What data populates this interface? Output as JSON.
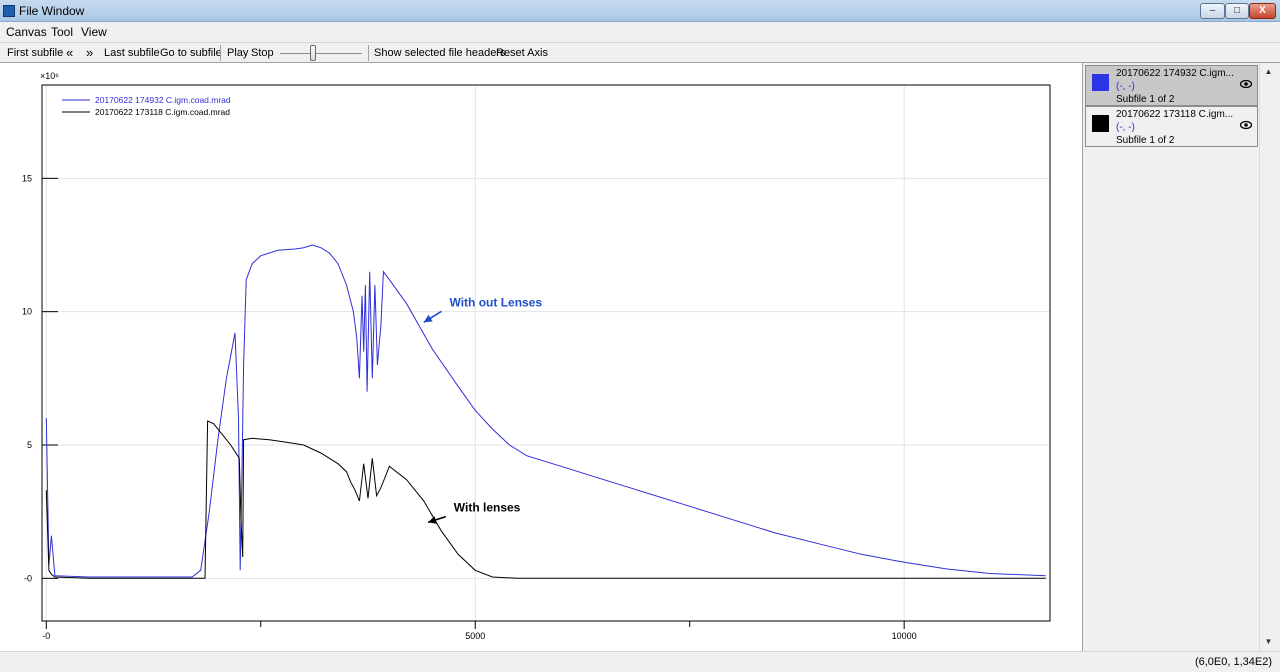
{
  "window": {
    "title": "File Window",
    "minimize": "–",
    "maximize": "□",
    "close": "X"
  },
  "menu": [
    "Canvas",
    "Tool",
    "View"
  ],
  "toolbar": {
    "first_subfile": "First subfile",
    "prev_icon": "«",
    "next_icon": "»",
    "last_subfile": "Last subfile",
    "go_to_subfile": "Go to subfile",
    "play": "Play",
    "stop": "Stop",
    "show_headers": "Show selected file headers",
    "reset_axis": "Reset Axis"
  },
  "colors": {
    "series_blue": "#2f2fd6",
    "series_black": "#000000",
    "annotation_blue": "#1f4fc8",
    "swatch_blue": "#2c35e6"
  },
  "legend_panel": [
    {
      "name": "20170622 174932 C.igm...",
      "coords": "(-, -)",
      "subfile": "Subfile 1 of 2",
      "color": "#2c35e6",
      "selected": true
    },
    {
      "name": "20170622 173118 C.igm...",
      "coords": "(-, -)",
      "subfile": "Subfile 1 of 2",
      "color": "#000000",
      "selected": false
    }
  ],
  "status": {
    "coords": "(6,0E0, 1,34E2)"
  },
  "chart_data": {
    "type": "line",
    "title": "",
    "xlabel": "",
    "ylabel": "",
    "y_multiplier": "×10⁶",
    "xlim": [
      -50,
      11700
    ],
    "ylim": [
      -1.6,
      18.5
    ],
    "x_ticks": [
      {
        "v": 0,
        "label": "-0"
      },
      {
        "v": 5000,
        "label": "5000"
      },
      {
        "v": 10000,
        "label": "10000"
      }
    ],
    "y_ticks": [
      {
        "v": 0,
        "label": "-0"
      },
      {
        "v": 5,
        "label": "5"
      },
      {
        "v": 10,
        "label": "10"
      },
      {
        "v": 15,
        "label": "15"
      }
    ],
    "grid": true,
    "legend_placement": "top-left",
    "series": [
      {
        "name": "20170622 174932 C.igm.coad.mrad",
        "color": "#2f2fd6",
        "points": [
          [
            0,
            6.0
          ],
          [
            30,
            0.5
          ],
          [
            60,
            1.6
          ],
          [
            100,
            0.1
          ],
          [
            500,
            0.05
          ],
          [
            1700,
            0.05
          ],
          [
            1800,
            0.3
          ],
          [
            1900,
            2.5
          ],
          [
            2000,
            5.2
          ],
          [
            2100,
            7.5
          ],
          [
            2200,
            9.2
          ],
          [
            2240,
            6.0
          ],
          [
            2260,
            0.3
          ],
          [
            2280,
            3.8
          ],
          [
            2300,
            8.0
          ],
          [
            2330,
            11.2
          ],
          [
            2400,
            11.8
          ],
          [
            2500,
            12.1
          ],
          [
            2700,
            12.3
          ],
          [
            2900,
            12.35
          ],
          [
            3000,
            12.4
          ],
          [
            3100,
            12.5
          ],
          [
            3200,
            12.4
          ],
          [
            3300,
            12.2
          ],
          [
            3400,
            11.8
          ],
          [
            3500,
            11.0
          ],
          [
            3580,
            10.0
          ],
          [
            3620,
            9.0
          ],
          [
            3650,
            7.5
          ],
          [
            3680,
            10.6
          ],
          [
            3700,
            8.5
          ],
          [
            3720,
            11.0
          ],
          [
            3740,
            7.0
          ],
          [
            3770,
            11.5
          ],
          [
            3800,
            7.5
          ],
          [
            3830,
            11.0
          ],
          [
            3860,
            8.0
          ],
          [
            3900,
            9.5
          ],
          [
            3930,
            11.5
          ],
          [
            4000,
            11.2
          ],
          [
            4200,
            10.3
          ],
          [
            4500,
            8.6
          ],
          [
            4800,
            7.2
          ],
          [
            5000,
            6.3
          ],
          [
            5200,
            5.6
          ],
          [
            5400,
            5.0
          ],
          [
            5600,
            4.6
          ],
          [
            6000,
            4.2
          ],
          [
            6500,
            3.7
          ],
          [
            7000,
            3.2
          ],
          [
            7500,
            2.7
          ],
          [
            8000,
            2.2
          ],
          [
            8500,
            1.7
          ],
          [
            9000,
            1.3
          ],
          [
            9500,
            0.9
          ],
          [
            10000,
            0.6
          ],
          [
            10500,
            0.35
          ],
          [
            11000,
            0.18
          ],
          [
            11650,
            0.1
          ]
        ]
      },
      {
        "name": "20170622 173118 C.igm.coad.mrad",
        "color": "#000000",
        "points": [
          [
            0,
            3.3
          ],
          [
            30,
            0.3
          ],
          [
            60,
            0.15
          ],
          [
            100,
            0.05
          ],
          [
            500,
            0.0
          ],
          [
            1850,
            0.0
          ],
          [
            1880,
            5.9
          ],
          [
            1950,
            5.8
          ],
          [
            2050,
            5.4
          ],
          [
            2150,
            5.0
          ],
          [
            2250,
            4.5
          ],
          [
            2270,
            2.2
          ],
          [
            2290,
            0.8
          ],
          [
            2300,
            5.2
          ],
          [
            2400,
            5.25
          ],
          [
            2600,
            5.2
          ],
          [
            2800,
            5.1
          ],
          [
            3000,
            5.0
          ],
          [
            3200,
            4.7
          ],
          [
            3400,
            4.3
          ],
          [
            3500,
            4.0
          ],
          [
            3550,
            3.6
          ],
          [
            3600,
            3.3
          ],
          [
            3650,
            2.9
          ],
          [
            3700,
            4.3
          ],
          [
            3750,
            3.0
          ],
          [
            3800,
            4.5
          ],
          [
            3850,
            3.1
          ],
          [
            3900,
            3.4
          ],
          [
            4000,
            4.2
          ],
          [
            4200,
            3.7
          ],
          [
            4400,
            2.9
          ],
          [
            4600,
            1.8
          ],
          [
            4800,
            0.9
          ],
          [
            5000,
            0.3
          ],
          [
            5200,
            0.05
          ],
          [
            5500,
            0.0
          ],
          [
            11650,
            0.0
          ]
        ]
      }
    ],
    "annotations": [
      {
        "text": "With out Lenses",
        "x": 4700,
        "y": 10.2,
        "color": "#1f4fc8",
        "arrow_to": [
          4400,
          9.6
        ]
      },
      {
        "text": "With lenses",
        "x": 4750,
        "y": 2.5,
        "color": "#000000",
        "arrow_to": [
          4450,
          2.1
        ]
      }
    ]
  }
}
